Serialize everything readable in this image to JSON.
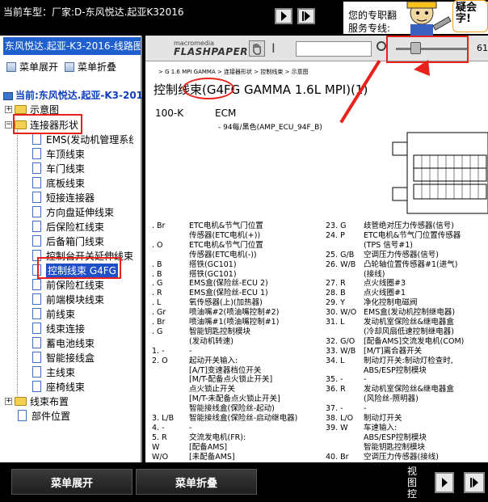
{
  "top": {
    "current_car_label": "当前车型：厂家:D-东风悦达.起亚K32016",
    "ad_line1": "您的专职翻",
    "ad_line2": "服务专线:",
    "bubble_text": "疑会 字!"
  },
  "left": {
    "title": "东风悦达.起亚-K3-2016-线路图",
    "expand_label": "菜单展开",
    "collapse_label": "菜单折叠",
    "root_label": "当前:东风悦达.起亚-K3-2016-",
    "folders": [
      "示意图",
      "连接器形状",
      "线束布置"
    ],
    "leaves": [
      "EMS(发动机管理系统",
      "车顶线束",
      "车门线束",
      "底板线束",
      "短接连接器",
      "方向盘延伸线束",
      "后保险杠线束",
      "后备箱门线束",
      "控制台开关延伸线束",
      "控制线束 G4FG",
      "前保险杠线束",
      "前端模块线束",
      "前线束",
      "线束连接",
      "蓄电池线束",
      "智能接线盒",
      "主线束",
      "座椅线束"
    ],
    "last_leaf": "部件位置"
  },
  "doc": {
    "logo_small": "macromedia",
    "logo_big": "FLASHPAPER",
    "zoom_value": "61",
    "breadcrumb": "> G 1.6 MPI GAMMA > 连接器形状 > 控制线束 > 示意图",
    "title": "控制线束(G4FG GAMMA 1.6L MPI)(1)",
    "sub_left": "100-K",
    "ecm": "ECM",
    "connector": "- 94每/黑色(AMP_ECU_94F_B)",
    "pins_left": [
      [
        ". Br",
        "ETC电机&节气门位置"
      ],
      [
        "",
        "传感器(ETC电机(+))"
      ],
      [
        ". O",
        "ETC电机&节气门位置"
      ],
      [
        "",
        "传感器(ETC电机(-))"
      ],
      [
        ". B",
        "搭铁(GC101)"
      ],
      [
        ". B",
        "搭铁(GC101)"
      ],
      [
        ". G",
        "EMS盒(保险丝-ECU 2)"
      ],
      [
        ". R",
        "EMS盒(保险丝-ECU 1)"
      ],
      [
        ". L",
        "氧传感器(上)(加热器)"
      ],
      [
        ". Gr",
        "喷油嘴#2(喷油嘴控制#2)"
      ],
      [
        ". Br",
        "喷油嘴#1(喷油嘴控制#1)"
      ],
      [
        ". G",
        "智能钥匙控制模块"
      ],
      [
        "",
        "(发动机转速)"
      ],
      [
        "1. -",
        "-"
      ],
      [
        "2. O",
        "起动开关输入:"
      ],
      [
        "",
        "[A/T]变速器档位开关"
      ],
      [
        "",
        "[M/T-配备点火锁止开关]"
      ],
      [
        "",
        "点火锁止开关"
      ],
      [
        "",
        "[M/T-未配备点火锁止开关]"
      ],
      [
        "",
        "智能接线盒(保险丝-起动)"
      ],
      [
        "3. L/B",
        "智能接线盒(保险丝-启动继电器)"
      ],
      [
        "4. -",
        "-"
      ],
      [
        "5. R",
        "交流发电机(FR):"
      ],
      [
        "W",
        "[配备AMS]"
      ],
      [
        "W/O",
        "[未配备AMS]"
      ]
    ],
    "pins_right": [
      [
        "23. G",
        "歧管绝对压力传感器(信号)"
      ],
      [
        "24. P",
        "ETC电机&节气门位置传感器"
      ],
      [
        "",
        "(TPS 信号#1)"
      ],
      [
        "25. G/B",
        "空调压力传感器(信号)"
      ],
      [
        "26. W/B",
        "凸轮轴位置传感器#1(进气)"
      ],
      [
        "",
        "(接线)"
      ],
      [
        "27. R",
        "点火线圈#3"
      ],
      [
        "28. B",
        "点火线圈#1"
      ],
      [
        "29. Y",
        "净化控制电磁阀"
      ],
      [
        "30. W/O",
        "EMS盒(发动机控制继电器)"
      ],
      [
        "31. L",
        "发动机室保险丝&继电器盒"
      ],
      [
        "",
        "(冷却风扇低速控制继电器)"
      ],
      [
        "32. G/O",
        "[配备AMS]交流发电机(COM)"
      ],
      [
        "33. W/B",
        "[M/T]离合器开关"
      ],
      [
        "34. L",
        "制动灯开关:制动灯检查时,"
      ],
      [
        "",
        "ABS/ESP控制模块"
      ],
      [
        "35. -",
        "-"
      ],
      [
        "36. R",
        "发动机室保险丝&继电器盒"
      ],
      [
        "",
        "(风险丝-照明器)"
      ],
      [
        "37. -",
        "-"
      ],
      [
        "38. L/O",
        "制动灯开关"
      ],
      [
        "39. W",
        "车速输入:"
      ],
      [
        "",
        "ABS/ESP控制模块"
      ],
      [
        "",
        "智能钥匙控制模块"
      ],
      [
        "40. Br",
        "空调压力传感器(接线)"
      ]
    ]
  },
  "bottom": {
    "expand_label": "菜单展开",
    "collapse_label": "菜单折叠",
    "view_ctrl": "视图控"
  },
  "colors": {
    "highlight_red": "#e8221a",
    "title_blue": "#1f5fd0",
    "selection_blue": "#2050c8"
  }
}
